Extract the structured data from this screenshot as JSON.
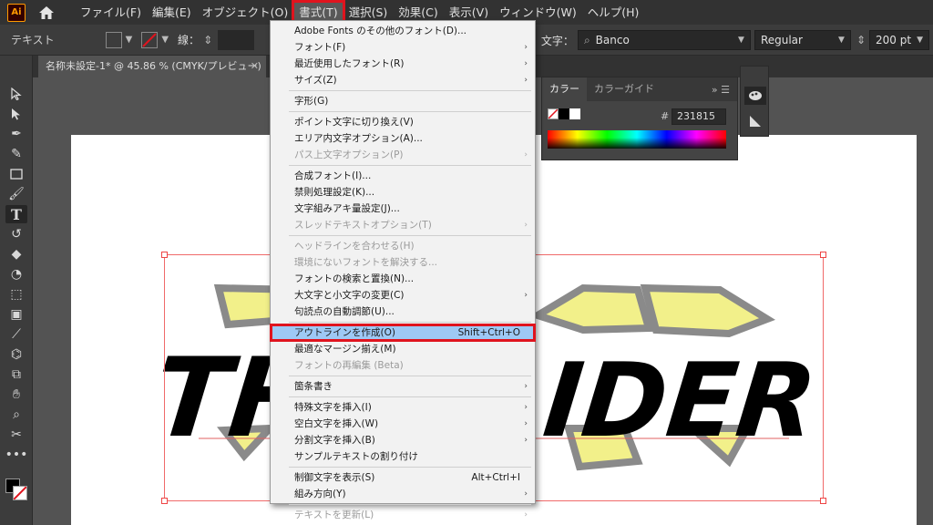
{
  "app": {
    "logo": "Ai"
  },
  "menubar": {
    "items": [
      "ファイル(F)",
      "編集(E)",
      "オブジェクト(O)",
      "書式(T)",
      "選択(S)",
      "効果(C)",
      "表示(V)",
      "ウィンドウ(W)",
      "ヘルプ(H)"
    ],
    "active_index": 3
  },
  "controlbar": {
    "label": "テキスト",
    "stroke_label": "線：",
    "char_label": "文字：",
    "font_name": "Banco",
    "font_style": "Regular",
    "font_size": "200 pt"
  },
  "document_tab": {
    "title": "名称未設定-1* @ 45.86 % (CMYK/プレビュー)"
  },
  "color_panel": {
    "tab_color": "カラー",
    "tab_guide": "カラーガイド",
    "hash": "#",
    "hex": "231815"
  },
  "artwork": {
    "visible_text": "TH    IDER"
  },
  "dropdown": {
    "items": [
      {
        "label": "Adobe Fonts のその他のフォント(D)...",
        "disabled": false,
        "submenu": false,
        "shortcut": ""
      },
      {
        "label": "フォント(F)",
        "disabled": false,
        "submenu": true,
        "shortcut": ""
      },
      {
        "label": "最近使用したフォント(R)",
        "disabled": false,
        "submenu": true,
        "shortcut": ""
      },
      {
        "label": "サイズ(Z)",
        "disabled": false,
        "submenu": true,
        "shortcut": ""
      },
      {
        "label": "字形(G)",
        "disabled": false,
        "submenu": false,
        "shortcut": ""
      },
      {
        "label": "ポイント文字に切り換え(V)",
        "disabled": false,
        "submenu": false,
        "shortcut": ""
      },
      {
        "label": "エリア内文字オプション(A)...",
        "disabled": false,
        "submenu": false,
        "shortcut": ""
      },
      {
        "label": "パス上文字オプション(P)",
        "disabled": true,
        "submenu": true,
        "shortcut": ""
      },
      {
        "label": "合成フォント(I)...",
        "disabled": false,
        "submenu": false,
        "shortcut": ""
      },
      {
        "label": "禁則処理設定(K)...",
        "disabled": false,
        "submenu": false,
        "shortcut": ""
      },
      {
        "label": "文字組みアキ量設定(J)...",
        "disabled": false,
        "submenu": false,
        "shortcut": ""
      },
      {
        "label": "スレッドテキストオプション(T)",
        "disabled": true,
        "submenu": true,
        "shortcut": ""
      },
      {
        "label": "ヘッドラインを合わせる(H)",
        "disabled": true,
        "submenu": false,
        "shortcut": ""
      },
      {
        "label": "環境にないフォントを解決する...",
        "disabled": true,
        "submenu": false,
        "shortcut": ""
      },
      {
        "label": "フォントの検索と置換(N)...",
        "disabled": false,
        "submenu": false,
        "shortcut": ""
      },
      {
        "label": "大文字と小文字の変更(C)",
        "disabled": false,
        "submenu": true,
        "shortcut": ""
      },
      {
        "label": "句読点の自動調節(U)...",
        "disabled": false,
        "submenu": false,
        "shortcut": ""
      },
      {
        "label": "アウトラインを作成(O)",
        "disabled": false,
        "submenu": false,
        "shortcut": "Shift+Ctrl+O",
        "highlight": true
      },
      {
        "label": "最適なマージン揃え(M)",
        "disabled": false,
        "submenu": false,
        "shortcut": ""
      },
      {
        "label": "フォントの再編集 (Beta)",
        "disabled": true,
        "submenu": false,
        "shortcut": ""
      },
      {
        "label": "箇条書き",
        "disabled": false,
        "submenu": true,
        "shortcut": ""
      },
      {
        "label": "特殊文字を挿入(I)",
        "disabled": false,
        "submenu": true,
        "shortcut": ""
      },
      {
        "label": "空白文字を挿入(W)",
        "disabled": false,
        "submenu": true,
        "shortcut": ""
      },
      {
        "label": "分割文字を挿入(B)",
        "disabled": false,
        "submenu": true,
        "shortcut": ""
      },
      {
        "label": "サンプルテキストの割り付け",
        "disabled": false,
        "submenu": false,
        "shortcut": ""
      },
      {
        "label": "制御文字を表示(S)",
        "disabled": false,
        "submenu": false,
        "shortcut": "Alt+Ctrl+I"
      },
      {
        "label": "組み方向(Y)",
        "disabled": false,
        "submenu": true,
        "shortcut": ""
      },
      {
        "label": "テキストを更新(L)",
        "disabled": true,
        "submenu": true,
        "shortcut": ""
      }
    ]
  },
  "colors": {
    "accent_red": "#e0141e",
    "highlight_blue": "#9ec9f5",
    "art_yellow": "#f2f08a",
    "art_black": "#000000"
  }
}
